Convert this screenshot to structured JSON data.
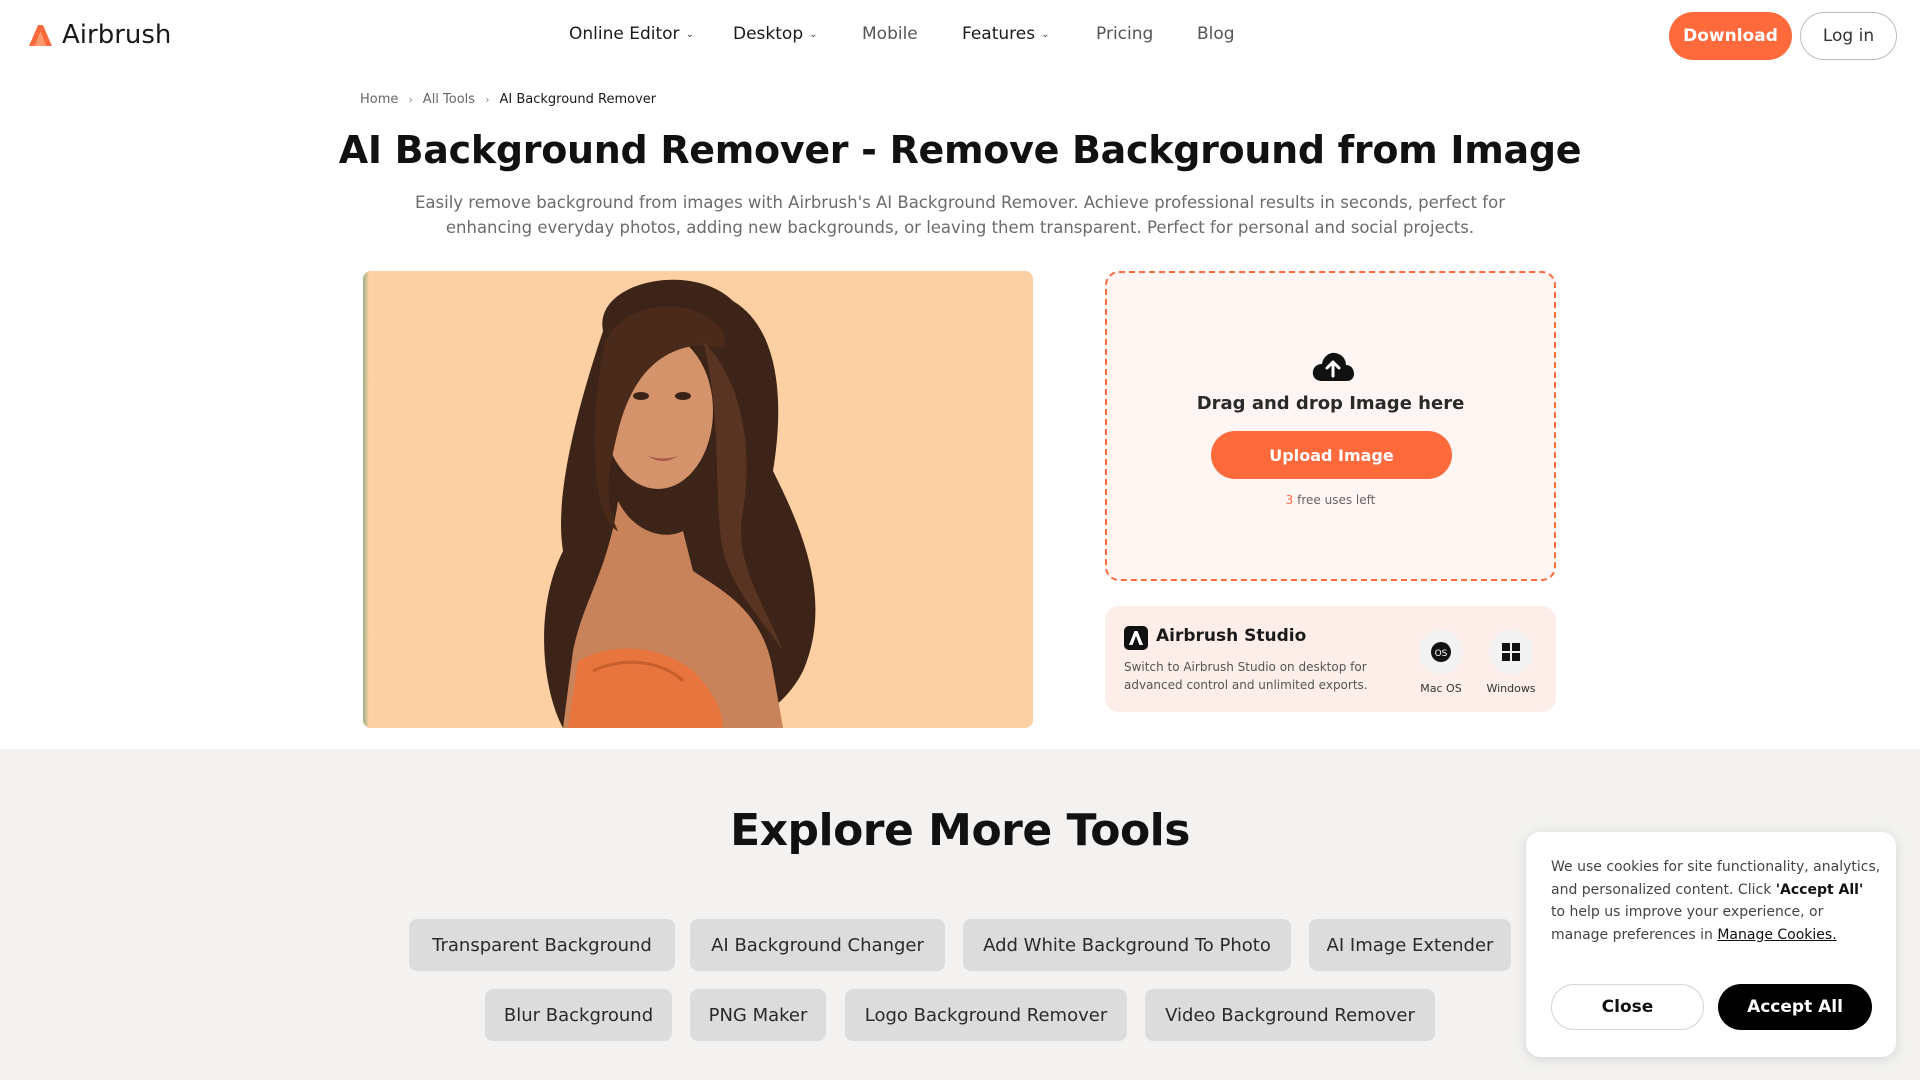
{
  "header": {
    "logo_text": "Airbrush",
    "nav": [
      {
        "label": "Online Editor",
        "dropdown": true
      },
      {
        "label": "Desktop",
        "dropdown": true
      },
      {
        "label": "Mobile",
        "dropdown": false
      },
      {
        "label": "Features",
        "dropdown": true
      },
      {
        "label": "Pricing",
        "dropdown": false
      },
      {
        "label": "Blog",
        "dropdown": false
      }
    ],
    "download_label": "Download",
    "login_label": "Log in"
  },
  "breadcrumb": [
    "Home",
    "All Tools",
    "AI Background Remover"
  ],
  "page": {
    "title": "AI Background Remover - Remove Background from Image",
    "subtitle": "Easily remove background from images with Airbrush's AI Background Remover. Achieve professional results in seconds, perfect for enhancing everyday photos, adding new backgrounds, or leaving them transparent. Perfect for personal and social projects."
  },
  "upload": {
    "drag_text": "Drag and drop Image here",
    "button_label": "Upload Image",
    "free_uses_count": "3",
    "free_uses_text": "free uses left"
  },
  "studio": {
    "title": "Airbrush Studio",
    "description": "Switch to Airbrush Studio on desktop for advanced control and unlimited exports.",
    "platforms": [
      {
        "label": "Mac OS",
        "icon": "macos-icon"
      },
      {
        "label": "Windows",
        "icon": "windows-icon"
      }
    ]
  },
  "explore": {
    "title": "Explore More Tools",
    "tools_row1": [
      "Transparent Background",
      "AI Background Changer",
      "Add White Background To Photo",
      "AI Image Extender"
    ],
    "tools_row2": [
      "Blur Background",
      "PNG Maker",
      "Logo Background Remover",
      "Video Background Remover"
    ]
  },
  "cookie": {
    "text_1": "We use cookies for site functionality, analytics, and personalized content. Click",
    "text_bold": "'Accept All'",
    "text_2": "to help us improve your experience, or manage preferences in",
    "manage_link": "Manage Cookies.",
    "close_label": "Close",
    "accept_label": "Accept All"
  },
  "colors": {
    "accent": "#ff6a3d",
    "preview_bg": "#fdd0a3",
    "upload_bg": "#fff6f4",
    "studio_bg": "#fdeeea",
    "explore_bg": "#f3f2f0"
  }
}
